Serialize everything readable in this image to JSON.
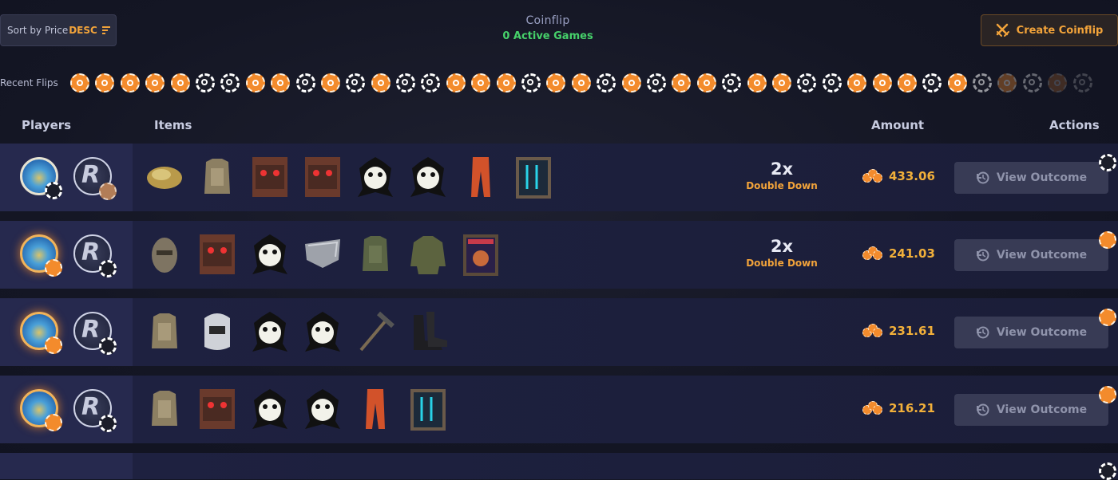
{
  "toolbar": {
    "sort_label": "Sort by Price",
    "sort_order": "DESC",
    "title": "Coinflip",
    "active_games": "0 Active Games",
    "create_label": "Create Coinflip"
  },
  "recent": {
    "label": "Recent Flips",
    "coins": [
      "orange",
      "orange",
      "orange",
      "orange",
      "orange",
      "white",
      "white",
      "orange",
      "orange",
      "white",
      "orange",
      "white",
      "orange",
      "white",
      "white",
      "orange",
      "orange",
      "orange",
      "white",
      "orange",
      "orange",
      "white",
      "orange",
      "white",
      "orange",
      "orange",
      "white",
      "orange",
      "orange",
      "white",
      "white",
      "orange",
      "orange",
      "orange",
      "white",
      "orange",
      "white",
      "orange",
      "white",
      "orange",
      "white"
    ]
  },
  "headers": {
    "players": "Players",
    "items": "Items",
    "amount": "Amount",
    "actions": "Actions"
  },
  "rows": [
    {
      "items": [
        "gold-ore",
        "armor-vest",
        "red-box",
        "red-box",
        "panda-rug",
        "panda-rug",
        "orange-pants",
        "neon-sign"
      ],
      "multiplier": "2x",
      "multiplier_label": "Double Down",
      "amount": "433.06",
      "action": "View Outcome",
      "p1_badge": "white",
      "p2_badge": "bronze"
    },
    {
      "items": [
        "metal-helmet",
        "red-box",
        "panda-rug",
        "shield",
        "green-vest",
        "green-jacket",
        "ramen-sign"
      ],
      "multiplier": "2x",
      "multiplier_label": "Double Down",
      "amount": "241.03",
      "action": "View Outcome",
      "p1_badge": "orange",
      "p2_badge": "white"
    },
    {
      "items": [
        "armor-vest",
        "welding-mask",
        "panda-rug",
        "panda-rug",
        "pickaxe",
        "boots"
      ],
      "multiplier": "",
      "multiplier_label": "",
      "amount": "231.61",
      "action": "View Outcome",
      "p1_badge": "orange",
      "p2_badge": "white"
    },
    {
      "items": [
        "armor-vest",
        "red-box",
        "panda-rug",
        "panda-rug",
        "orange-pants",
        "neon-sign"
      ],
      "multiplier": "",
      "multiplier_label": "",
      "amount": "216.21",
      "action": "View Outcome",
      "p1_badge": "orange",
      "p2_badge": "white"
    }
  ],
  "colors": {
    "accent": "#f2a33a",
    "green": "#46d16a",
    "row": "#1c1f3c"
  }
}
